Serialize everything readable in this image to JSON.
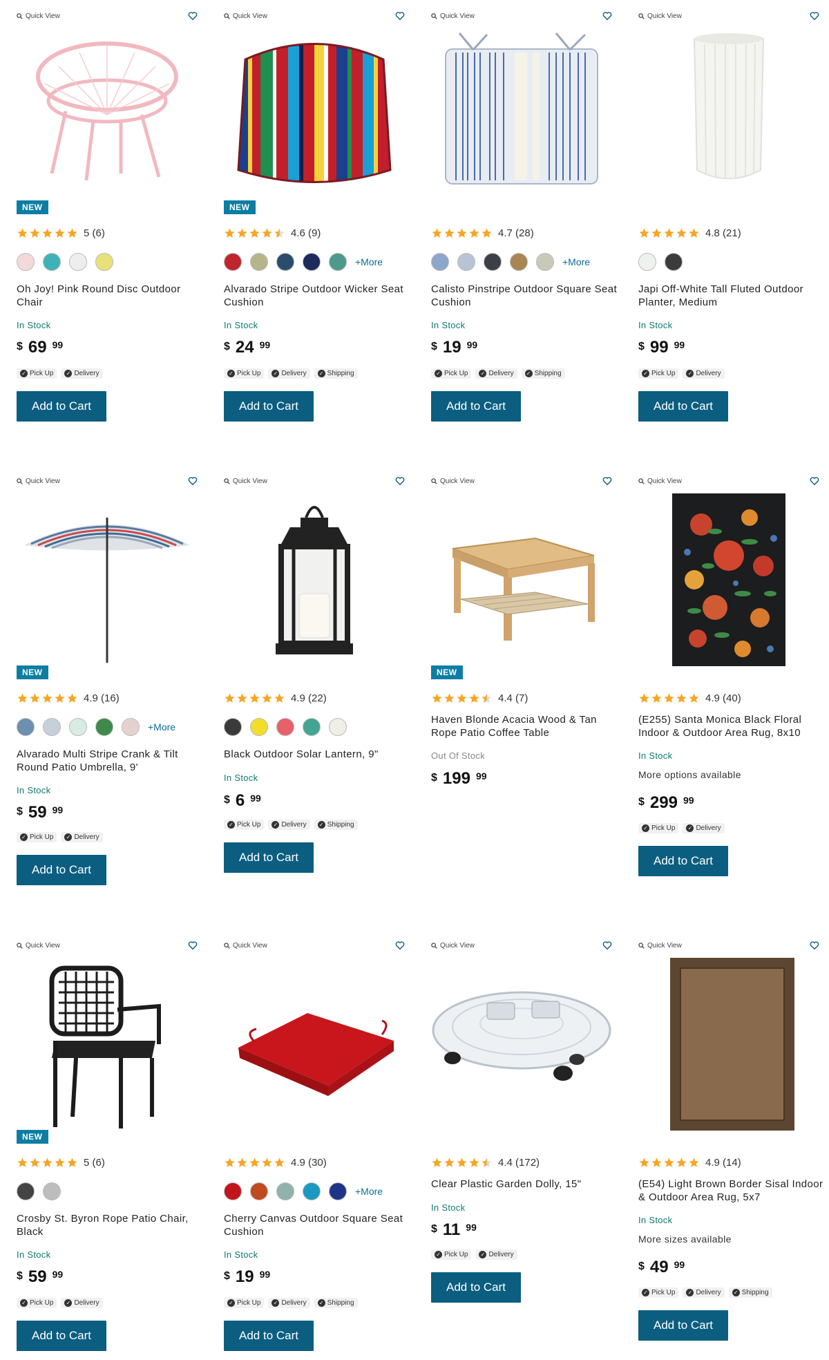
{
  "common": {
    "quick_view": "Quick View",
    "add_to_cart": "Add to Cart",
    "currency": "$",
    "more_swatches": "+More"
  },
  "colors": {
    "accent": "#0b5e80",
    "badge": "#0d7ea3",
    "star": "#f5a623",
    "in_stock": "#0d7a70"
  },
  "products": [
    {
      "name": "Oh Joy! Pink Round Disc Outdoor Chair",
      "badge": "NEW",
      "rating": "5 (6)",
      "stars": 5,
      "swatches": [
        "#f3d9dc",
        "#3fb2b7",
        "#eeeeee",
        "#e8e07a"
      ],
      "more": false,
      "stock": "In Stock",
      "price_dollars": "69",
      "price_cents": "99",
      "fulfillment": [
        "Pick Up",
        "Delivery"
      ],
      "image_icon": "chair-icon"
    },
    {
      "name": "Alvarado Stripe Outdoor Wicker Seat Cushion",
      "badge": "NEW",
      "rating": "4.6 (9)",
      "stars": 4.5,
      "swatches": [
        "#c0252e",
        "#b6b58a",
        "#2a4d6e",
        "#1c2a5c",
        "#4c9a8c"
      ],
      "more": true,
      "stock": "In Stock",
      "price_dollars": "24",
      "price_cents": "99",
      "fulfillment": [
        "Pick Up",
        "Delivery",
        "Shipping"
      ],
      "image_icon": "cushion-icon"
    },
    {
      "name": "Calisto Pinstripe Outdoor Square Seat Cushion",
      "badge": "",
      "rating": "4.7 (28)",
      "stars": 5,
      "swatches": [
        "#8da6cc",
        "#b8c4d6",
        "#3c3f45",
        "#a88552",
        "#c9c9b8"
      ],
      "more": true,
      "stock": "In Stock",
      "price_dollars": "19",
      "price_cents": "99",
      "fulfillment": [
        "Pick Up",
        "Delivery",
        "Shipping"
      ],
      "image_icon": "cushion-icon"
    },
    {
      "name": "Japi Off-White Tall Fluted Outdoor Planter, Medium",
      "badge": "",
      "rating": "4.8 (21)",
      "stars": 5,
      "swatches": [
        "#eef2ef",
        "#3b3b3b"
      ],
      "more": false,
      "stock": "In Stock",
      "price_dollars": "99",
      "price_cents": "99",
      "fulfillment": [
        "Pick Up",
        "Delivery"
      ],
      "image_icon": "planter-icon"
    },
    {
      "name": "Alvarado Multi Stripe Crank & Tilt Round Patio Umbrella, 9'",
      "badge": "NEW",
      "rating": "4.9 (16)",
      "stars": 5,
      "swatches": [
        "#6d8fb0",
        "#c7cfd8",
        "#d9ece4",
        "#3f8a4b",
        "#e5d2cf"
      ],
      "more": true,
      "stock": "In Stock",
      "price_dollars": "59",
      "price_cents": "99",
      "fulfillment": [
        "Pick Up",
        "Delivery"
      ],
      "image_icon": "umbrella-icon"
    },
    {
      "name": "Black Outdoor Solar Lantern, 9\"",
      "badge": "",
      "rating": "4.9 (22)",
      "stars": 5,
      "swatches": [
        "#3a3a3a",
        "#f2dd2c",
        "#e8606a",
        "#43a494",
        "#efefe6"
      ],
      "more": false,
      "stock": "In Stock",
      "price_dollars": "6",
      "price_cents": "99",
      "fulfillment": [
        "Pick Up",
        "Delivery",
        "Shipping"
      ],
      "image_icon": "lantern-icon"
    },
    {
      "name": "Haven Blonde Acacia Wood & Tan Rope Patio Coffee Table",
      "badge": "NEW",
      "rating": "4.4 (7)",
      "stars": 4.5,
      "swatches": [],
      "more": false,
      "stock": "Out Of Stock",
      "price_dollars": "199",
      "price_cents": "99",
      "fulfillment": [],
      "image_icon": "table-icon"
    },
    {
      "name": "(E255) Santa Monica Black Floral Indoor & Outdoor Area Rug, 8x10",
      "badge": "",
      "rating": "4.9 (40)",
      "stars": 5,
      "swatches": [],
      "more": false,
      "stock": "In Stock",
      "options": "More options available",
      "price_dollars": "299",
      "price_cents": "99",
      "fulfillment": [
        "Pick Up",
        "Delivery"
      ],
      "image_icon": "rug-icon"
    },
    {
      "name": "Crosby St. Byron Rope Patio Chair, Black",
      "badge": "NEW",
      "rating": "5 (6)",
      "stars": 5,
      "swatches": [
        "#444444",
        "#bdbdbd"
      ],
      "more": false,
      "stock": "In Stock",
      "price_dollars": "59",
      "price_cents": "99",
      "fulfillment": [
        "Pick Up",
        "Delivery"
      ],
      "image_icon": "chair-icon"
    },
    {
      "name": "Cherry Canvas Outdoor Square Seat Cushion",
      "badge": "",
      "rating": "4.9 (30)",
      "stars": 5,
      "swatches": [
        "#c2161c",
        "#c24a1f",
        "#8fb2ac",
        "#1b99c0",
        "#1f3487"
      ],
      "more": true,
      "stock": "In Stock",
      "price_dollars": "19",
      "price_cents": "99",
      "fulfillment": [
        "Pick Up",
        "Delivery",
        "Shipping"
      ],
      "image_icon": "cushion-icon"
    },
    {
      "name": "Clear Plastic Garden Dolly, 15\"",
      "badge": "",
      "rating": "4.4 (172)",
      "stars": 4.5,
      "swatches": [],
      "more": false,
      "stock": "In Stock",
      "price_dollars": "11",
      "price_cents": "99",
      "fulfillment": [
        "Pick Up",
        "Delivery"
      ],
      "image_icon": "dolly-icon"
    },
    {
      "name": "(E54) Light Brown Border Sisal Indoor & Outdoor Area Rug, 5x7",
      "badge": "",
      "rating": "4.9 (14)",
      "stars": 5,
      "swatches": [],
      "more": false,
      "stock": "In Stock",
      "options": "More sizes available",
      "price_dollars": "49",
      "price_cents": "99",
      "fulfillment": [
        "Pick Up",
        "Delivery",
        "Shipping"
      ],
      "image_icon": "rug-icon"
    }
  ]
}
